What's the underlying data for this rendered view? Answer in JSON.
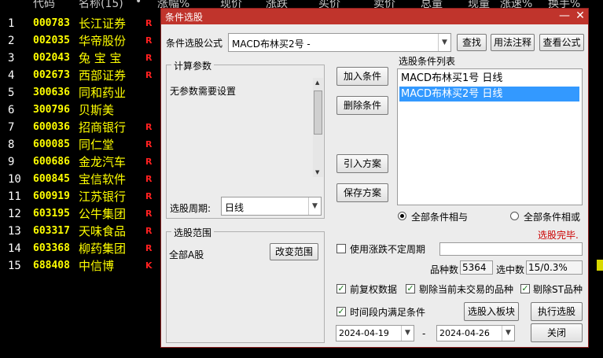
{
  "header": {
    "code": "代码",
    "name": "名称(15)",
    "dot": "•",
    "change_pct": "涨幅%",
    "price": "现价",
    "change": "涨跌",
    "bid": "买价",
    "ask": "卖价",
    "volume": "总量",
    "cur_vol": "现量",
    "speed": "涨速%",
    "turnover": "换手%"
  },
  "stocks": [
    {
      "idx": "1",
      "code": "000783",
      "name": "长江证券",
      "mark": "R"
    },
    {
      "idx": "2",
      "code": "002035",
      "name": "华帝股份",
      "mark": "R"
    },
    {
      "idx": "3",
      "code": "002043",
      "name": "兔 宝 宝",
      "mark": "R"
    },
    {
      "idx": "4",
      "code": "002673",
      "name": "西部证券",
      "mark": "R"
    },
    {
      "idx": "5",
      "code": "300636",
      "name": "同和药业",
      "mark": ""
    },
    {
      "idx": "6",
      "code": "300796",
      "name": "贝斯美",
      "mark": ""
    },
    {
      "idx": "7",
      "code": "600036",
      "name": "招商银行",
      "mark": "R"
    },
    {
      "idx": "8",
      "code": "600085",
      "name": "同仁堂",
      "mark": "R"
    },
    {
      "idx": "9",
      "code": "600686",
      "name": "金龙汽车",
      "mark": "R"
    },
    {
      "idx": "10",
      "code": "600845",
      "name": "宝信软件",
      "mark": "R"
    },
    {
      "idx": "11",
      "code": "600919",
      "name": "江苏银行",
      "mark": "R"
    },
    {
      "idx": "12",
      "code": "603195",
      "name": "公牛集团",
      "mark": "R"
    },
    {
      "idx": "13",
      "code": "603317",
      "name": "天味食品",
      "mark": "R"
    },
    {
      "idx": "14",
      "code": "603368",
      "name": "柳药集团",
      "mark": "R"
    },
    {
      "idx": "15",
      "code": "688408",
      "name": "中信博",
      "mark": "K"
    }
  ],
  "dialog": {
    "title": "条件选股",
    "formula_label": "条件选股公式",
    "formula_value": "MACD布林买2号 -",
    "find_button": "查找",
    "usage_button": "用法注释",
    "view_formula_button": "查看公式",
    "params_group": "计算参数",
    "params_text": "无参数需要设置",
    "period_label": "选股周期:",
    "period_value": "日线",
    "add_condition": "加入条件",
    "delete_condition": "删除条件",
    "import_plan": "引入方案",
    "save_plan": "保存方案",
    "list_title": "选股条件列表",
    "conditions": [
      {
        "text": "MACD布林买1号  日线",
        "selected": false
      },
      {
        "text": "MACD布林买2号  日线",
        "selected": true
      }
    ],
    "radio_and": "全部条件相与",
    "radio_or": "全部条件相或",
    "status": "选股完毕.",
    "range_group": "选股范围",
    "range_value": "全部A股",
    "change_range": "改变范围",
    "irregular_period": "使用涨跌不定周期",
    "count_label": "品种数",
    "count_value": "5364",
    "selected_label": "选中数",
    "selected_value": "15/0.3%",
    "forward_adjust": "前复权数据",
    "remove_untraded": "剔除当前未交易的品种",
    "remove_st": "剔除ST品种",
    "time_range": "时间段内满足条件",
    "to_board": "选股入板块",
    "execute": "执行选股",
    "close": "关闭",
    "date_from": "2024-04-19",
    "date_sep": "-",
    "date_to": "2024-04-26"
  },
  "colors": {
    "titlebar": "#c0342c",
    "selection": "#3399ff",
    "status": "#cc0000",
    "code_text": "#ffff00"
  }
}
